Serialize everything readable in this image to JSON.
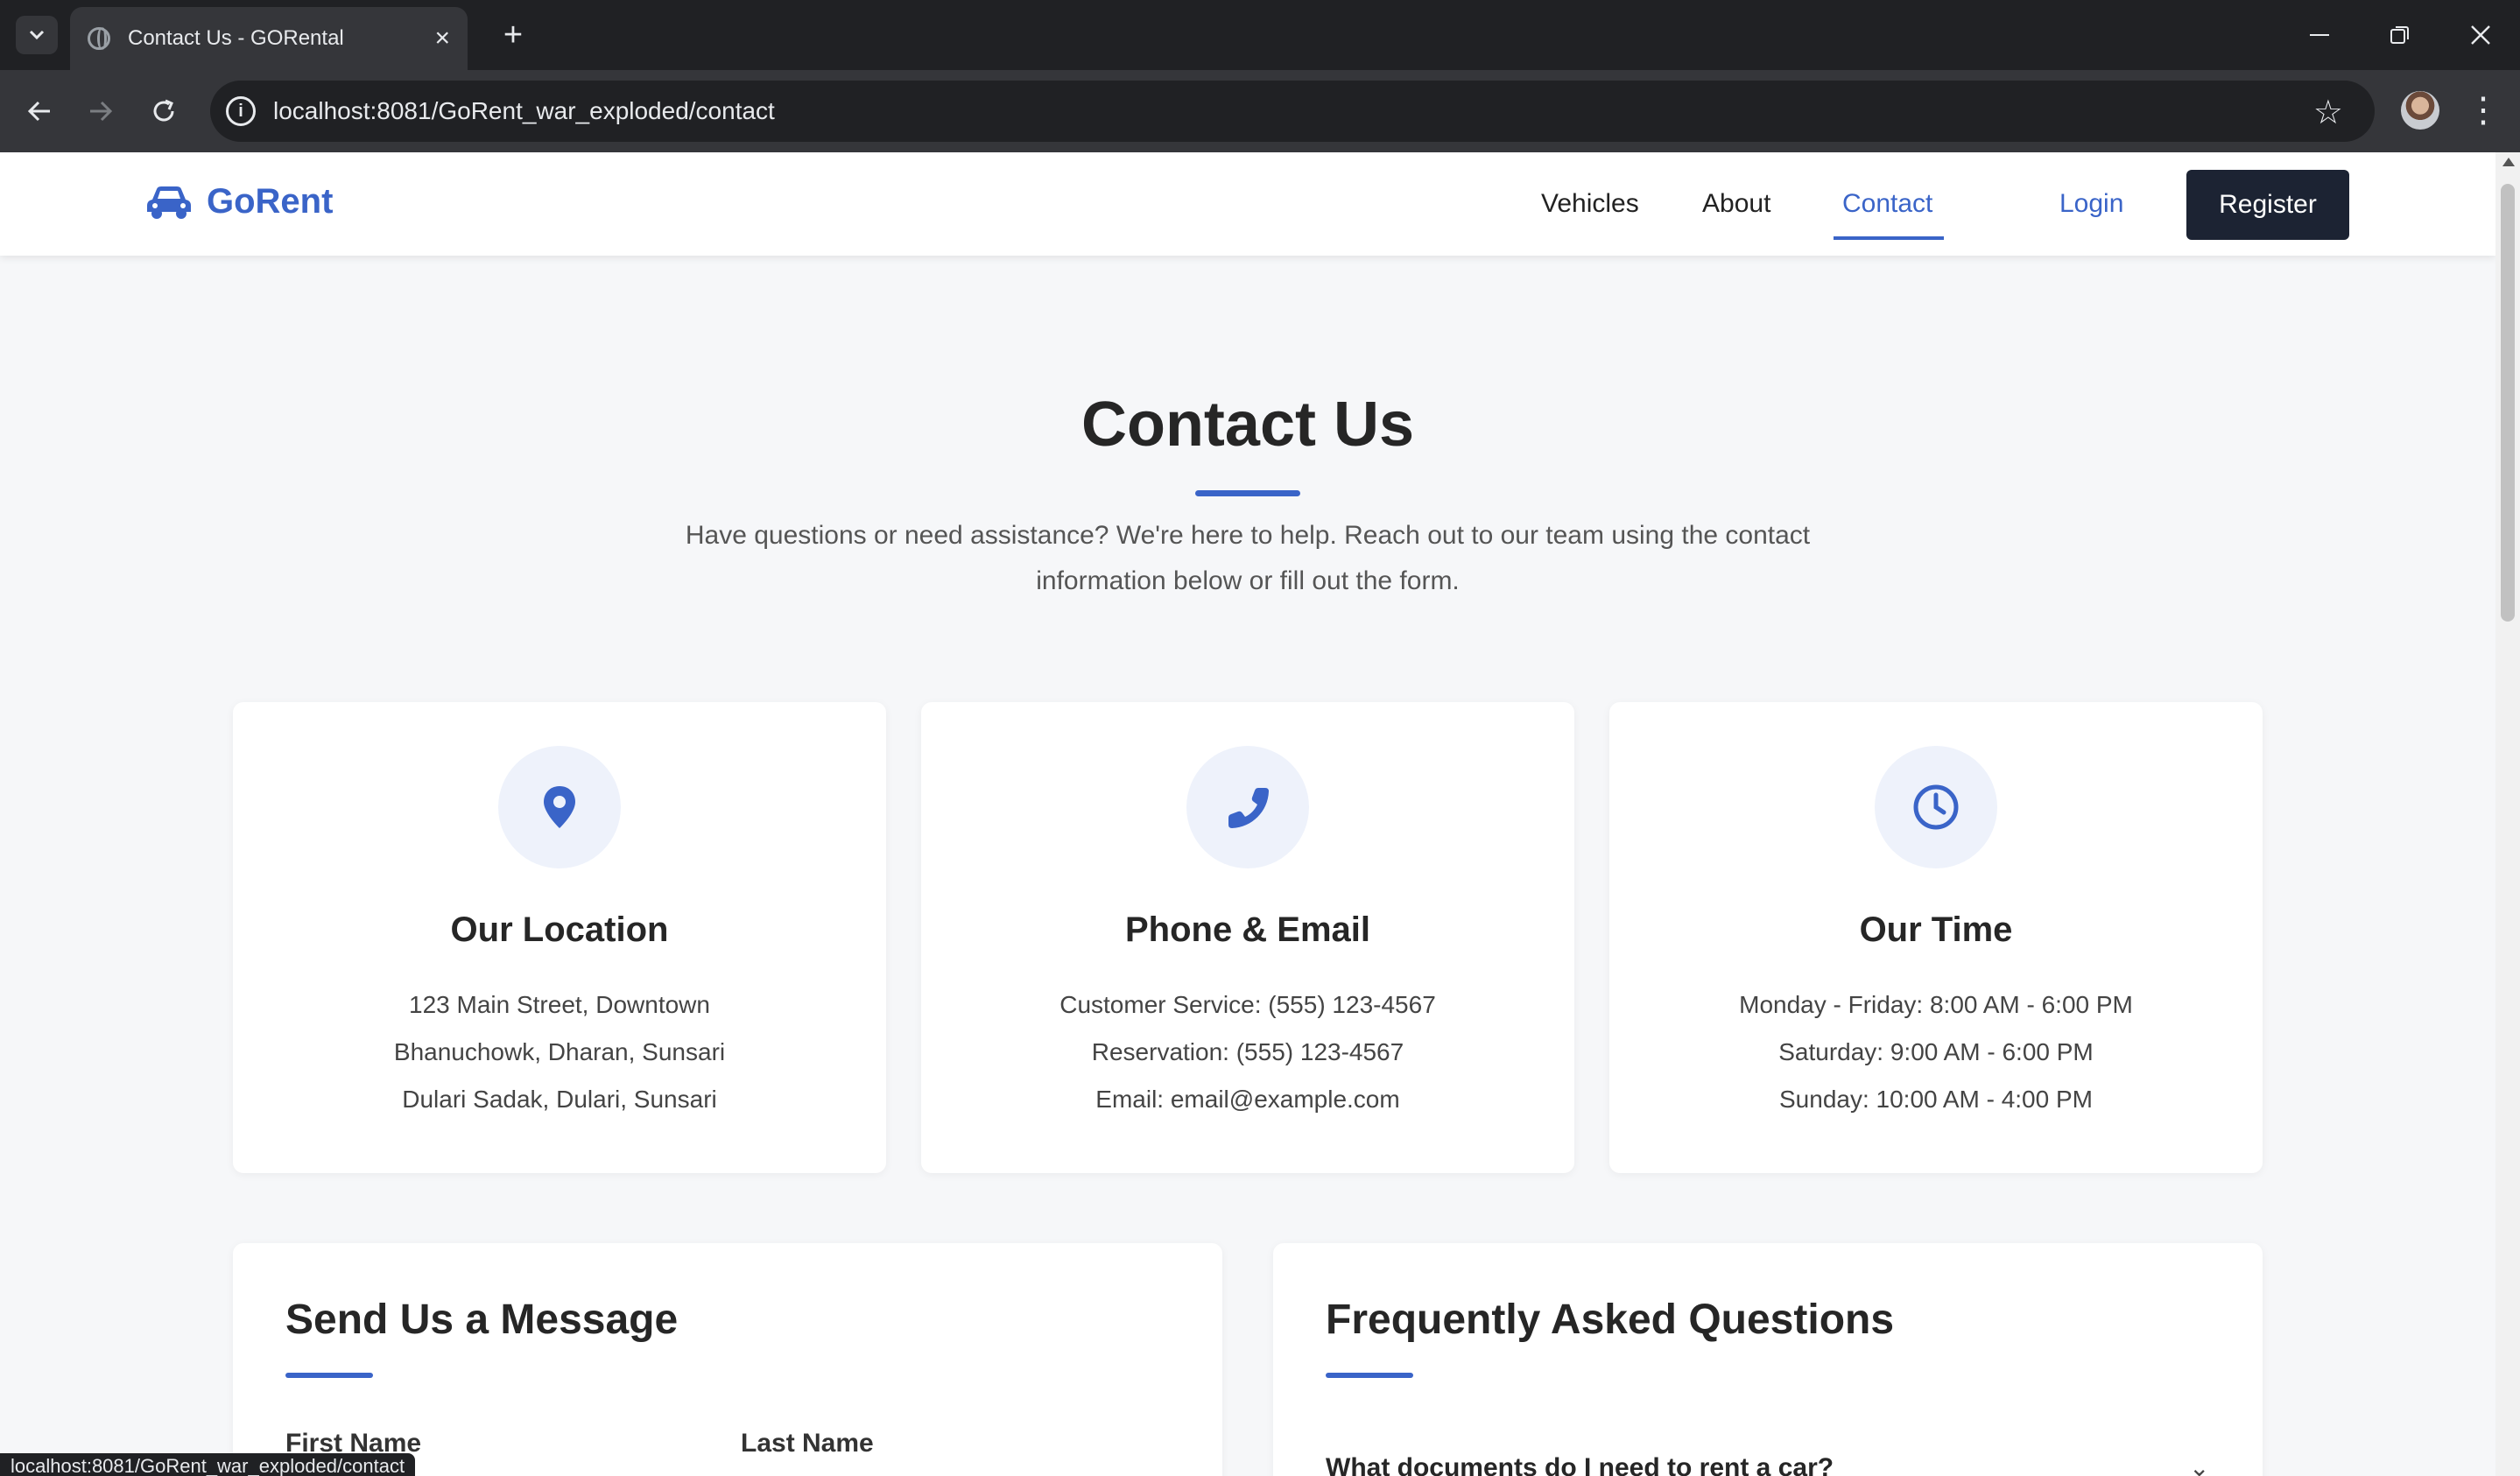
{
  "browser": {
    "tab_title": "Contact Us - GORental",
    "url": "localhost:8081/GoRent_war_exploded/contact",
    "status_url": "localhost:8081/GoRent_war_exploded/contact"
  },
  "site": {
    "brand": "GoRent",
    "nav": {
      "vehicles": "Vehicles",
      "about": "About",
      "contact": "Contact",
      "login": "Login",
      "register": "Register"
    },
    "accent_color": "#3a64c8"
  },
  "hero": {
    "title": "Contact Us",
    "intro_line1": "Have questions or need assistance? We're here to help. Reach out to our team using the contact",
    "intro_line2": "information below or fill out the form."
  },
  "cards": [
    {
      "icon": "map-pin-icon",
      "title": "Our Location",
      "lines": [
        "123 Main Street, Downtown",
        "Bhanuchowk, Dharan, Sunsari",
        "Dulari Sadak, Dulari, Sunsari"
      ]
    },
    {
      "icon": "phone-icon",
      "title": "Phone & Email",
      "lines": [
        "Customer Service: (555) 123-4567",
        "Reservation: (555) 123-4567",
        "Email: email@example.com"
      ]
    },
    {
      "icon": "clock-icon",
      "title": "Our Time",
      "lines": [
        "Monday - Friday: 8:00 AM - 6:00 PM",
        "Saturday: 9:00 AM - 6:00 PM",
        "Sunday: 10:00 AM - 4:00 PM"
      ]
    }
  ],
  "message_form": {
    "title": "Send Us a Message",
    "first_name_label": "First Name",
    "last_name_label": "Last Name"
  },
  "faq": {
    "title": "Frequently Asked Questions",
    "first_question": "What documents do I need to rent a car?"
  }
}
